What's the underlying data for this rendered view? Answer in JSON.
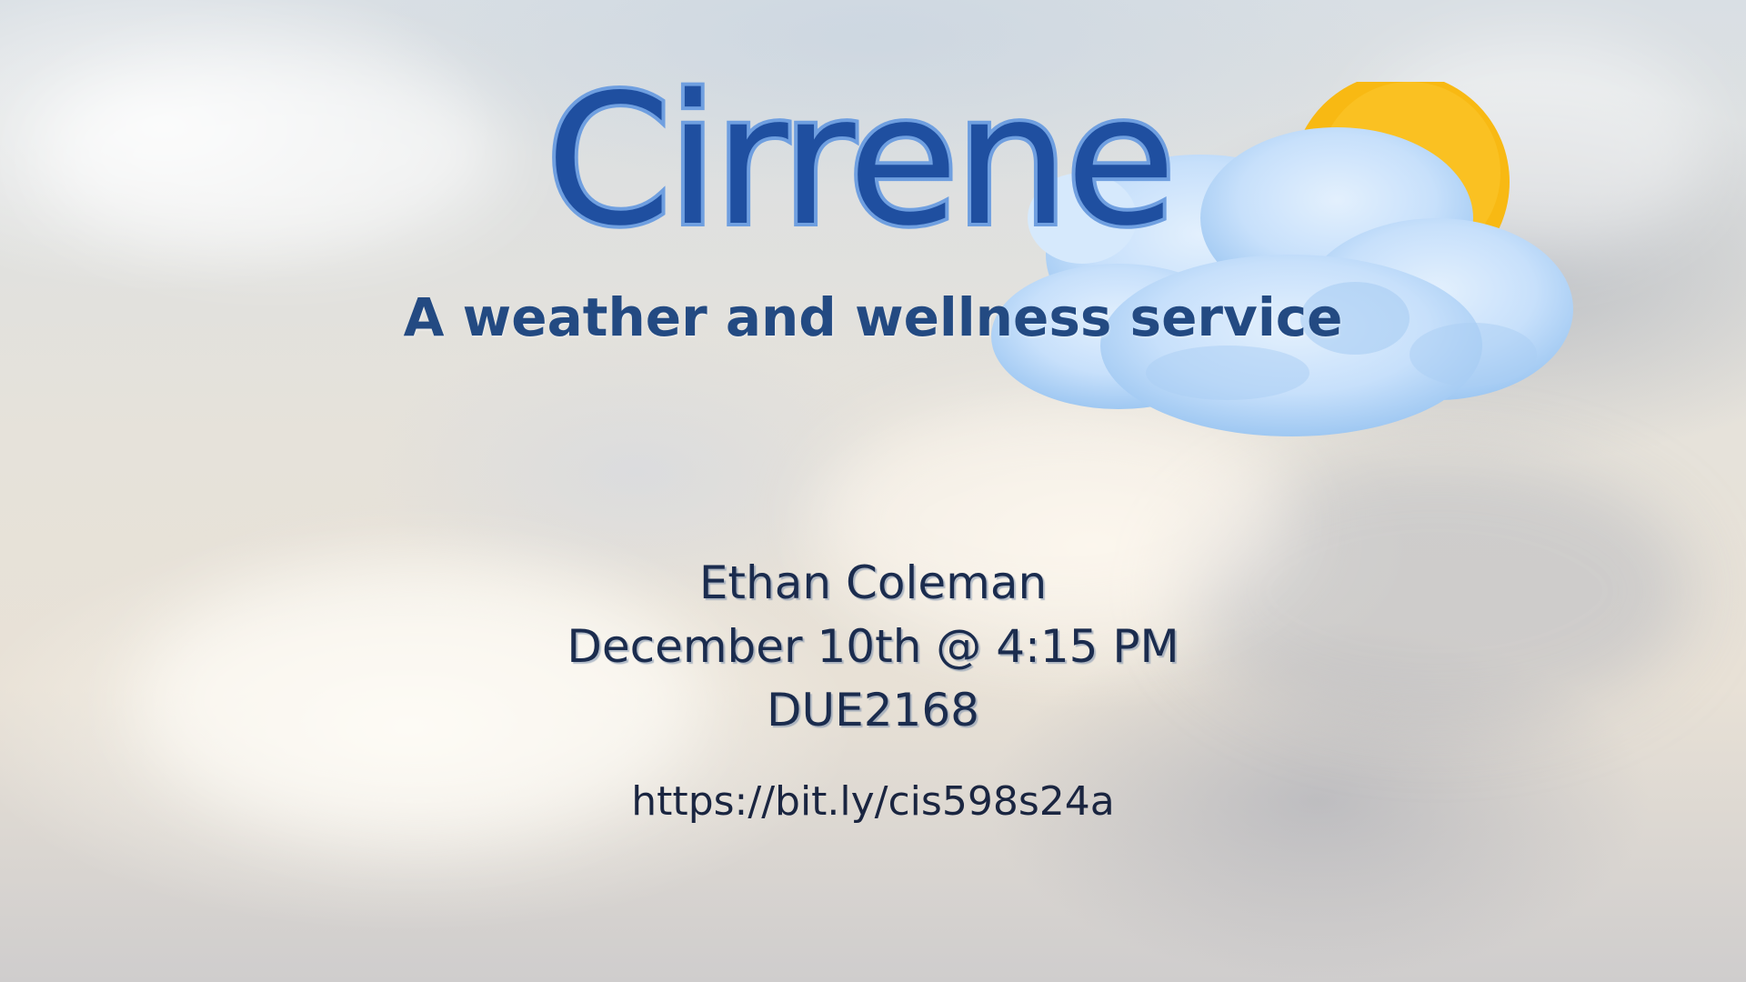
{
  "brand": {
    "name": "Cirrene",
    "tagline": "A weather and wellness service",
    "logo_icon": "sun-behind-cloud-icon",
    "colors": {
      "title_fill": "#1f4fa0",
      "title_outline": "#6f9fe0",
      "tagline": "#234a82",
      "sun": "#f8b913",
      "cloud": "#c7e0fb"
    }
  },
  "presentation": {
    "presenter": "Ethan Coleman",
    "datetime": "December 10th @ 4:15 PM",
    "room": "DUE2168",
    "link": "https://bit.ly/cis598s24a"
  }
}
